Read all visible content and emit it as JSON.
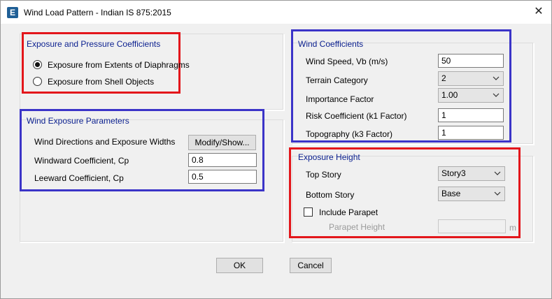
{
  "window": {
    "title": "Wind Load Pattern - Indian IS 875:2015",
    "close_glyph": "✕",
    "app_icon_letter": "E"
  },
  "exposure_pressure": {
    "title": "Exposure and Pressure Coefficients",
    "options": [
      {
        "label": "Exposure from Extents of Diaphragms",
        "checked": true
      },
      {
        "label": "Exposure from Shell Objects",
        "checked": false
      }
    ]
  },
  "wind_exposure": {
    "title": "Wind Exposure Parameters",
    "directions_label": "Wind Directions and Exposure Widths",
    "modify_button": "Modify/Show...",
    "windward_label": "Windward Coefficient, Cp",
    "windward_value": "0.8",
    "leeward_label": "Leeward Coefficient, Cp",
    "leeward_value": "0.5"
  },
  "wind_coefficients": {
    "title": "Wind Coefficients",
    "wind_speed_label": "Wind Speed, Vb (m/s)",
    "wind_speed_value": "50",
    "terrain_label": "Terrain Category",
    "terrain_value": "2",
    "importance_label": "Importance Factor",
    "importance_value": "1.00",
    "risk_label": "Risk Coefficient (k1 Factor)",
    "risk_value": "1",
    "topography_label": "Topography (k3 Factor)",
    "topography_value": "1"
  },
  "exposure_height": {
    "title": "Exposure Height",
    "top_story_label": "Top Story",
    "top_story_value": "Story3",
    "bottom_story_label": "Bottom Story",
    "bottom_story_value": "Base",
    "include_parapet_label": "Include Parapet",
    "include_parapet_checked": false,
    "parapet_height_label": "Parapet Height",
    "parapet_height_value": "",
    "parapet_unit": "m"
  },
  "footer": {
    "ok_label": "OK",
    "cancel_label": "Cancel"
  },
  "colors": {
    "highlight_red": "#e3161b",
    "highlight_blue": "#3b34c8",
    "group_title": "#0a1f8f"
  }
}
